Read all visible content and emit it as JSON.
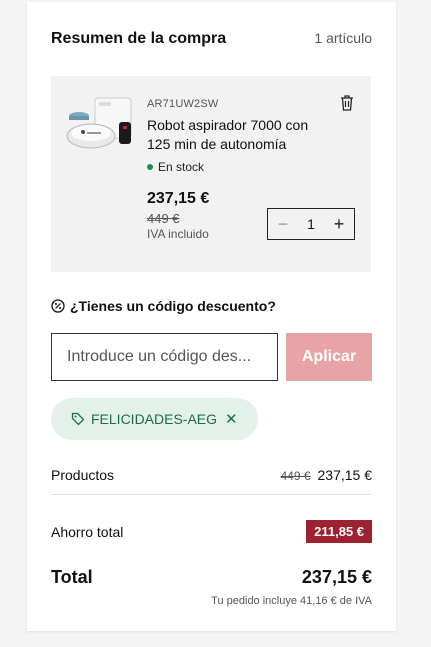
{
  "summary": {
    "title": "Resumen de la compra",
    "item_count": "1 artículo"
  },
  "product": {
    "sku": "AR71UW2SW",
    "name": "Robot aspirador 7000 con 125 min de autonomía",
    "stock": "En stock",
    "price": "237,15 €",
    "old_price": "449 €",
    "vat": "IVA incluido",
    "quantity": "1",
    "image_icon": "robot-vacuum-image",
    "delete_icon": "trash-icon",
    "stock_color": "#1f8f45"
  },
  "promo": {
    "title": "¿Tienes un código descuento?",
    "placeholder": "Introduce un código des...",
    "apply_label": "Aplicar",
    "apply_color": "#e8a3a7",
    "applied_code": "FELICIDADES-AEG"
  },
  "totals": {
    "products_label": "Productos",
    "products_old": "449 €",
    "products_value": "237,15 €",
    "savings_label": "Ahorro total",
    "savings_value": "211,85 €",
    "savings_color": "#9c2230",
    "total_label": "Total",
    "total_value": "237,15 €",
    "vat_note": "Tu pedido incluye 41,16 € de IVA"
  }
}
